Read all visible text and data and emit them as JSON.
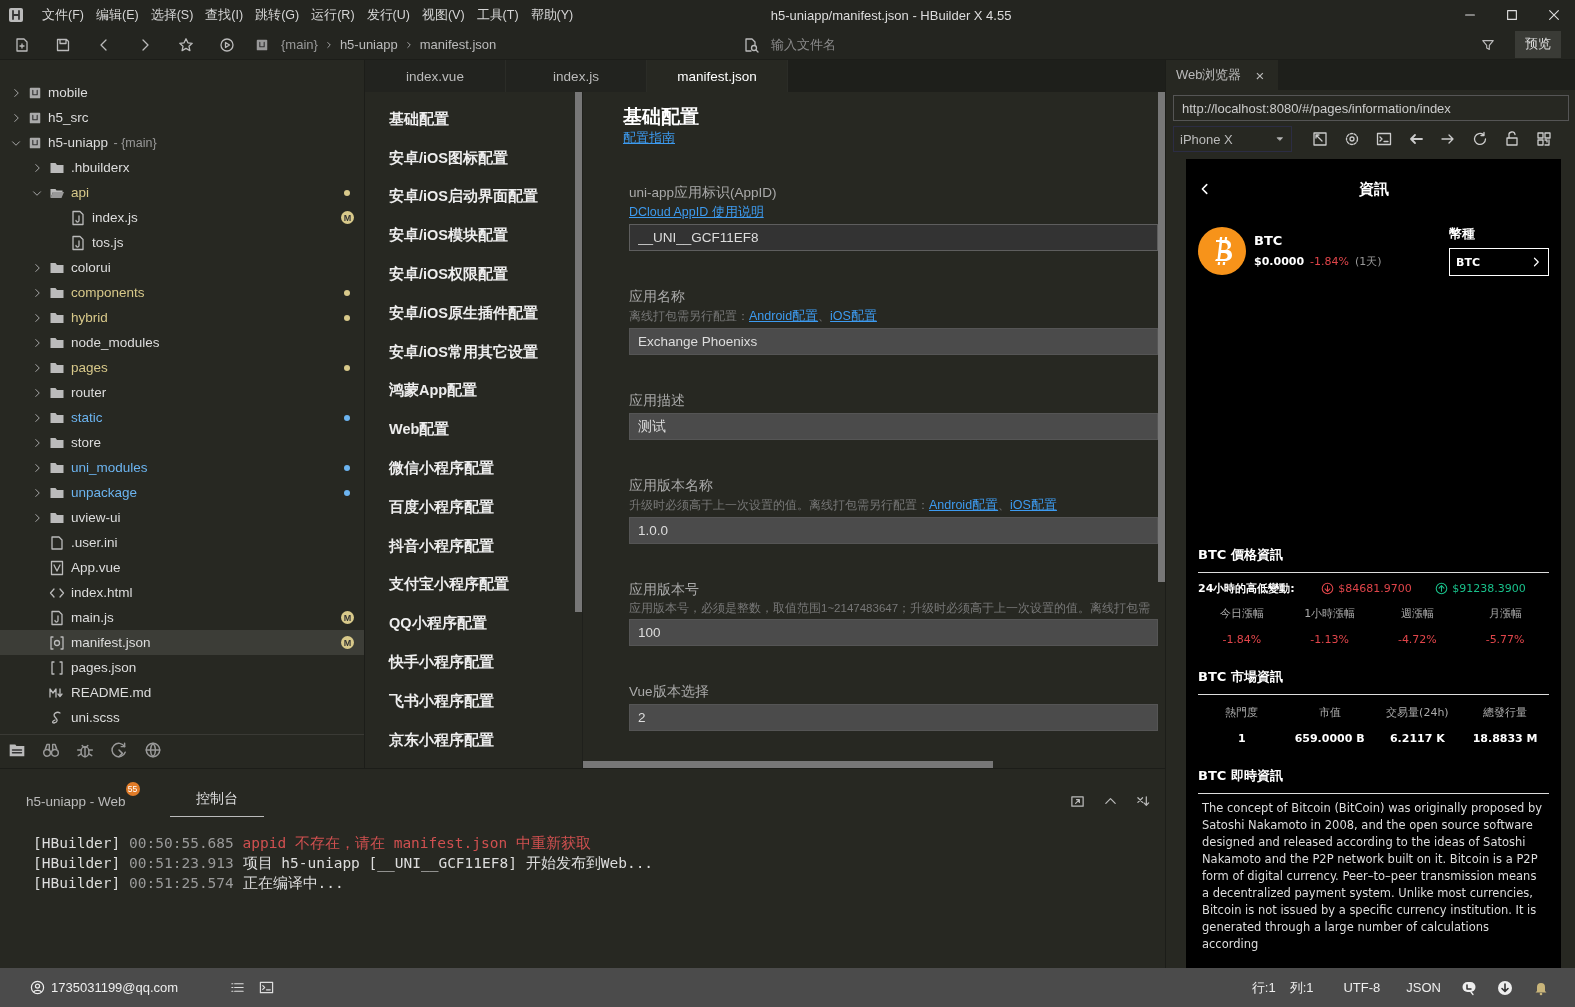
{
  "window": {
    "title": "h5-uniapp/manifest.json - HBuilder X 4.55"
  },
  "menu": [
    "文件(F)",
    "编辑(E)",
    "选择(S)",
    "查找(I)",
    "跳转(G)",
    "运行(R)",
    "发行(U)",
    "视图(V)",
    "工具(T)",
    "帮助(Y)"
  ],
  "toolbar": {
    "breadcrumb": [
      "{main}",
      "h5-uniapp",
      "manifest.json"
    ],
    "search": {
      "placeholder": "输入文件名"
    },
    "preview_button": "预览"
  },
  "file_tree": [
    {
      "name": "mobile",
      "kind": "project",
      "expanded": false,
      "selected": false
    },
    {
      "name": "h5_src",
      "kind": "project",
      "expanded": false,
      "selected": false
    },
    {
      "name": "h5-uniapp",
      "branch": "- {main}",
      "kind": "project",
      "expanded": true,
      "selected": false,
      "children": [
        {
          "name": ".hbuilderx",
          "kind": "folder",
          "expanded": false,
          "selected": false
        },
        {
          "name": "api",
          "kind": "folder",
          "expanded": true,
          "selected": false,
          "color": "#d8c98a",
          "children": [
            {
              "name": "index.js",
              "kind": "file-js",
              "selected": false,
              "badge": "M"
            },
            {
              "name": "tos.js",
              "kind": "file-js",
              "selected": false
            }
          ]
        },
        {
          "name": "colorui",
          "kind": "folder",
          "expanded": false,
          "selected": false
        },
        {
          "name": "components",
          "kind": "folder",
          "expanded": false,
          "selected": false,
          "color": "#d8c98a"
        },
        {
          "name": "hybrid",
          "kind": "folder",
          "expanded": false,
          "selected": false,
          "color": "#d8c98a"
        },
        {
          "name": "node_modules",
          "kind": "folder",
          "expanded": false,
          "selected": false
        },
        {
          "name": "pages",
          "kind": "folder",
          "expanded": false,
          "selected": false,
          "color": "#d8c98a"
        },
        {
          "name": "router",
          "kind": "folder",
          "expanded": false,
          "selected": false
        },
        {
          "name": "static",
          "kind": "folder",
          "expanded": false,
          "selected": false,
          "color": "#6cb4f0"
        },
        {
          "name": "store",
          "kind": "folder",
          "expanded": false,
          "selected": false
        },
        {
          "name": "uni_modules",
          "kind": "folder",
          "expanded": false,
          "selected": false,
          "color": "#6cb4f0"
        },
        {
          "name": "unpackage",
          "kind": "folder",
          "expanded": false,
          "selected": false,
          "color": "#6cb4f0"
        },
        {
          "name": "uview-ui",
          "kind": "folder",
          "expanded": false,
          "selected": false
        },
        {
          "name": ".user.ini",
          "kind": "file-plain",
          "selected": false
        },
        {
          "name": "App.vue",
          "kind": "file-vue",
          "selected": false
        },
        {
          "name": "index.html",
          "kind": "file-html",
          "selected": false
        },
        {
          "name": "main.js",
          "kind": "file-js",
          "selected": false,
          "badge": "M"
        },
        {
          "name": "manifest.json",
          "kind": "file-config",
          "selected": true,
          "badge": "M"
        },
        {
          "name": "pages.json",
          "kind": "file-json",
          "selected": false
        },
        {
          "name": "README.md",
          "kind": "file-md",
          "selected": false
        },
        {
          "name": "uni.scss",
          "kind": "file-scss",
          "selected": false
        }
      ]
    }
  ],
  "editor_tabs": [
    {
      "label": "index.vue",
      "selected": false
    },
    {
      "label": "index.js",
      "selected": false
    },
    {
      "label": "manifest.json",
      "selected": true
    }
  ],
  "settings_nav": [
    "基础配置",
    "安卓/iOS图标配置",
    "安卓/iOS启动界面配置",
    "安卓/iOS模块配置",
    "安卓/iOS权限配置",
    "安卓/iOS原生插件配置",
    "安卓/iOS常用其它设置",
    "鸿蒙App配置",
    "Web配置",
    "微信小程序配置",
    "百度小程序配置",
    "抖音小程序配置",
    "支付宝小程序配置",
    "QQ小程序配置",
    "快手小程序配置",
    "飞书小程序配置",
    "京东小程序配置"
  ],
  "form": {
    "title": "基础配置",
    "guide_link": "配置指南",
    "fields": [
      {
        "label": "uni-app应用标识(AppID)",
        "links": [
          "DCloud AppID 使用说明"
        ],
        "value": "__UNI__GCF11EF8",
        "readonly": true
      },
      {
        "label": "应用名称",
        "hint": "离线打包需另行配置：",
        "links": [
          "Android配置",
          "iOS配置"
        ],
        "separator": "、",
        "value": "Exchange Phoenixs",
        "readonly": false
      },
      {
        "label": "应用描述",
        "value": "测试",
        "readonly": false
      },
      {
        "label": "应用版本名称",
        "hint": "升级时必须高于上一次设置的值。离线打包需另行配置：",
        "links": [
          "Android配置",
          "iOS配置"
        ],
        "separator": "、",
        "value": "1.0.0",
        "readonly": false
      },
      {
        "label": "应用版本号",
        "hint": "应用版本号，必须是整数，取值范围1~2147483647；升级时必须高于上一次设置的值。离线打包需",
        "value": "100",
        "readonly": false
      },
      {
        "label": "Vue版本选择",
        "value": "2",
        "readonly": false
      }
    ]
  },
  "browser": {
    "tab": {
      "label": "Web浏览器",
      "close": "×"
    },
    "url": "http://localhost:8080/#/pages/information/index",
    "device": "iPhone X",
    "page": {
      "title": "資訊",
      "coin": {
        "symbol": "BTC",
        "price": "$0.0000",
        "change": "-1.84%",
        "period": "(1天)"
      },
      "picker": {
        "label": "幣種",
        "value": "BTC"
      },
      "price_section": {
        "title": "BTC 價格資訊",
        "range_label": "24小時的高低變動:",
        "low": "$84681.9700",
        "high": "$91238.3900",
        "stats": [
          {
            "label": "今日漲幅",
            "value": "-1.84%",
            "negative": true
          },
          {
            "label": "1小時漲幅",
            "value": "-1.13%",
            "negative": true
          },
          {
            "label": "週漲幅",
            "value": "-4.72%",
            "negative": true
          },
          {
            "label": "月漲幅",
            "value": "-5.77%",
            "negative": true
          }
        ]
      },
      "market_section": {
        "title": "BTC 市場資訊",
        "stats": [
          {
            "label": "熱門度",
            "value": "1",
            "negative": false
          },
          {
            "label": "市值",
            "value": "659.0000 B",
            "negative": false
          },
          {
            "label": "交易量(24h)",
            "value": "6.2117 K",
            "negative": false
          },
          {
            "label": "總發行量",
            "value": "18.8833 M",
            "negative": false
          }
        ]
      },
      "news_section": {
        "title": "BTC 即時資訊",
        "text": "The concept of Bitcoin (BitCoin) was originally proposed by Satoshi Nakamoto in 2008, and the open source software designed and released according to the ideas of Satoshi Nakamoto and the P2P network built on it. Bitcoin is a P2P form of digital currency. Peer–to–peer transmission means a decentralized payment system. Unlike most currencies, Bitcoin is not issued by a specific currency institution. It is generated through a large number of calculations according"
      }
    }
  },
  "console": {
    "tabs": [
      {
        "label": "h5-uniapp - Web",
        "badge": "55",
        "selected": false
      },
      {
        "label": "控制台",
        "selected": true
      }
    ],
    "lines": [
      {
        "source": "[HBuilder]",
        "time": "00:50:55.685",
        "message": "appid 不存在，请在 manifest.json 中重新获取",
        "error": true
      },
      {
        "source": "[HBuilder]",
        "time": "00:51:23.913",
        "message": "项目 h5-uniapp [__UNI__GCF11EF8] 开始发布到Web...",
        "error": false
      },
      {
        "source": "[HBuilder]",
        "time": "00:51:25.574",
        "message": "正在编译中...",
        "error": false
      }
    ]
  },
  "status_bar": {
    "user": "1735031199@qq.com",
    "position": [
      "行:1",
      "列:1"
    ],
    "encoding": "UTF-8",
    "language": "JSON"
  }
}
